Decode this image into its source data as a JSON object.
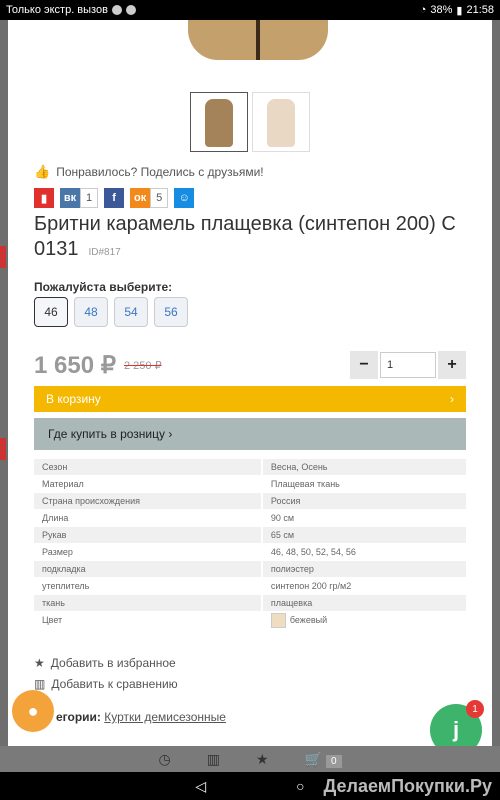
{
  "status": {
    "carrier_text": "Только экстр. вызов",
    "battery": "38%",
    "time": "21:58"
  },
  "product": {
    "like_text": "Понравилось? Поделись с друзьями!",
    "share": {
      "vk_count": "1",
      "ok_count": "5"
    },
    "title": "Бритни карамель плащевка (синтепон 200) С 0131",
    "id_label": "ID#817",
    "choose_label": "Пожалуйста выберите:",
    "sizes": [
      "46",
      "48",
      "54",
      "56"
    ],
    "selected_size": "46",
    "price": "1 650 ₽",
    "old_price": "2 250 ₽",
    "quantity": "1",
    "cart_button": "В корзину",
    "retail_button": "Где купить в розницу",
    "specs": [
      {
        "k": "Сезон",
        "v": "Весна, Осень"
      },
      {
        "k": "Материал",
        "v": "Плащевая ткань"
      },
      {
        "k": "Страна происхождения",
        "v": "Россия"
      },
      {
        "k": "Длина",
        "v": "90 см"
      },
      {
        "k": "Рукав",
        "v": "65 см"
      },
      {
        "k": "Размер",
        "v": "46, 48, 50, 52, 54, 56"
      },
      {
        "k": "подкладка",
        "v": "полиэстер"
      },
      {
        "k": "утеплитель",
        "v": "синтепон 200 гр/м2"
      },
      {
        "k": "ткань",
        "v": "плащевка"
      },
      {
        "k": "Цвет",
        "v": "бежевый"
      }
    ],
    "add_favorites": "Добавить в избранное",
    "add_compare": "Добавить к сравнению",
    "categories_label": "егории:",
    "category_link": "Куртки демисезонные"
  },
  "fab_badge": "1",
  "cart_count": "0",
  "watermark": "ДелаемПокупки.Ру",
  "colors": {
    "accent_yellow": "#f5b800",
    "retail_gray": "#aab8b8",
    "fab_green": "#3db36b",
    "chat_orange": "#f4a23a"
  }
}
